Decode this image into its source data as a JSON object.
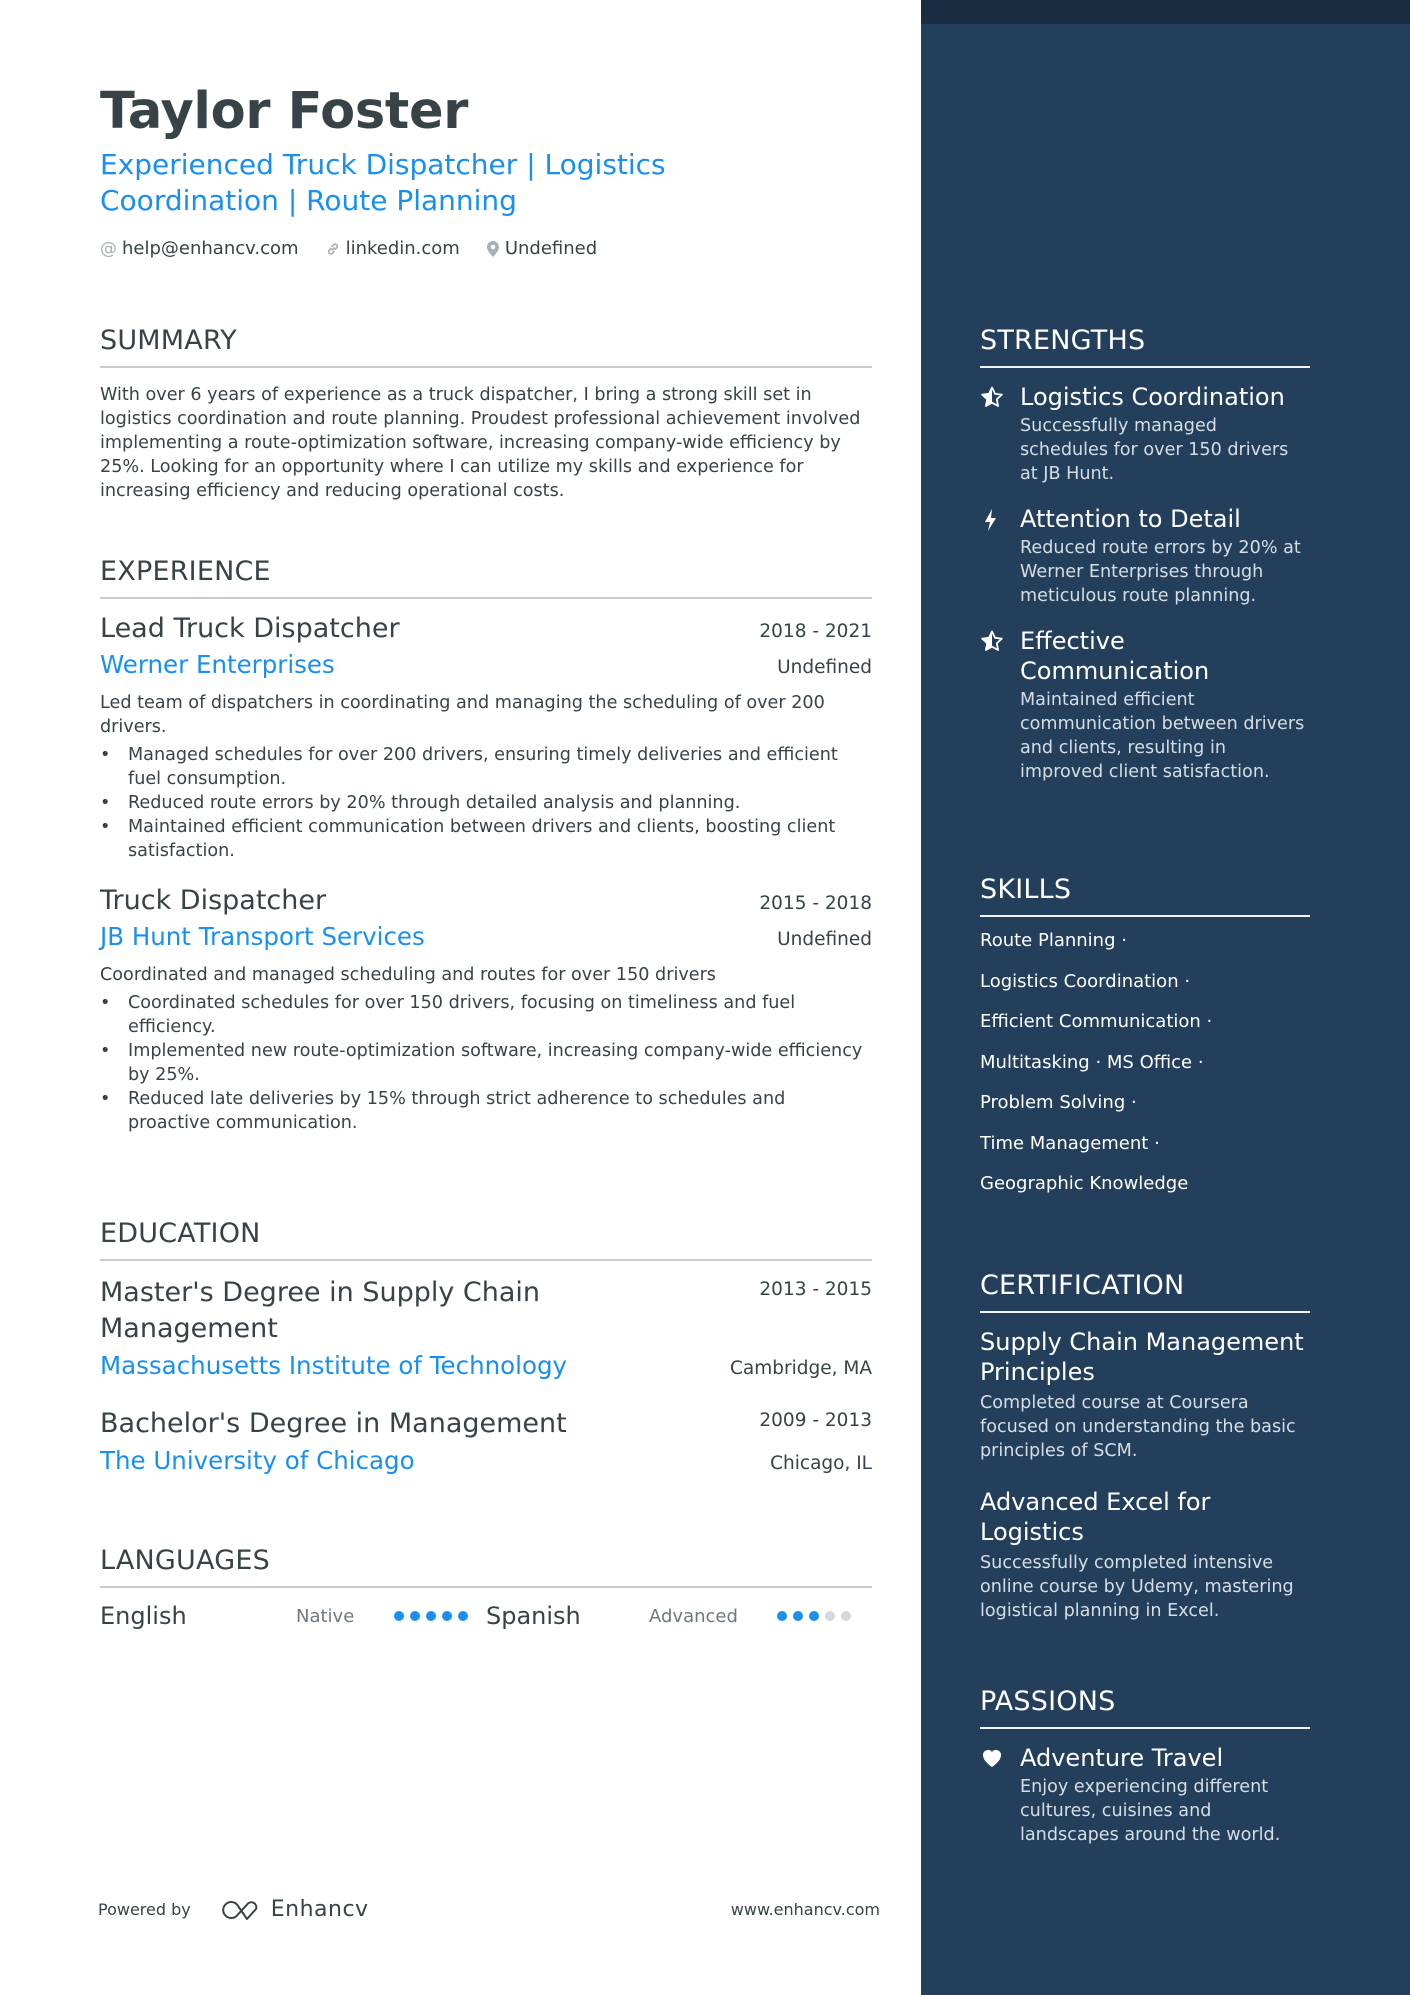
{
  "header": {
    "name": "Taylor Foster",
    "headline": "Experienced Truck Dispatcher | Logistics Coordination | Route Planning",
    "contacts": [
      {
        "icon": "at-icon",
        "text": "help@enhancv.com"
      },
      {
        "icon": "link-icon",
        "text": "linkedin.com"
      },
      {
        "icon": "location-pin-icon",
        "text": "Undefined"
      }
    ]
  },
  "summary": {
    "title": "SUMMARY",
    "text": "With over 6 years of experience as a truck dispatcher, I bring a strong skill set in logistics coordination and route planning. Proudest professional achievement involved implementing a route-optimization software, increasing company-wide efficiency by 25%. Looking for an opportunity where I can utilize my skills and experience for increasing efficiency and reducing operational costs."
  },
  "experience": {
    "title": "EXPERIENCE",
    "jobs": [
      {
        "title": "Lead Truck Dispatcher",
        "dates": "2018 - 2021",
        "company": "Werner Enterprises",
        "location": "Undefined",
        "description": "Led team of dispatchers in coordinating and managing the scheduling of over 200 drivers.",
        "bullets": [
          "Managed schedules for over 200 drivers, ensuring timely deliveries and efficient fuel consumption.",
          "Reduced route errors by 20% through detailed analysis and planning.",
          "Maintained efficient communication between drivers and clients, boosting client satisfaction."
        ]
      },
      {
        "title": "Truck Dispatcher",
        "dates": "2015 - 2018",
        "company": "JB Hunt Transport Services",
        "location": "Undefined",
        "description": "Coordinated and managed scheduling and routes for over 150 drivers",
        "bullets": [
          "Coordinated schedules for over 150 drivers, focusing on timeliness and fuel efficiency.",
          "Implemented new route-optimization software, increasing company-wide efficiency by 25%.",
          "Reduced late deliveries by 15% through strict adherence to schedules and proactive communication."
        ]
      }
    ]
  },
  "education": {
    "title": "EDUCATION",
    "items": [
      {
        "degree": "Master's Degree in Supply Chain Management",
        "dates": "2013 - 2015",
        "school": "Massachusetts Institute of Technology",
        "location": "Cambridge, MA"
      },
      {
        "degree": "Bachelor's Degree in Management",
        "dates": "2009 - 2013",
        "school": "The University of Chicago",
        "location": "Chicago, IL"
      }
    ]
  },
  "languages": {
    "title": "LANGUAGES",
    "items": [
      {
        "name": "English",
        "level": "Native",
        "rating": 5,
        "max": 5
      },
      {
        "name": "Spanish",
        "level": "Advanced",
        "rating": 3,
        "max": 5
      }
    ]
  },
  "footer": {
    "powered_by": "Powered by",
    "brand": "Enhancv",
    "website": "www.enhancv.com"
  },
  "strengths": {
    "title": "STRENGTHS",
    "items": [
      {
        "icon": "star-half-icon",
        "title": "Logistics Coordination",
        "description": "Successfully managed schedules for over 150 drivers at JB Hunt."
      },
      {
        "icon": "lightning-bolt-icon",
        "title": "Attention to Detail",
        "description": "Reduced route errors by 20% at Werner Enterprises through meticulous route planning."
      },
      {
        "icon": "star-half-icon",
        "title": "Effective Communication",
        "description": "Maintained efficient communication between drivers and clients, resulting in improved client satisfaction."
      }
    ]
  },
  "skills": {
    "title": "SKILLS",
    "lines": [
      "Route Planning ·",
      "Logistics Coordination ·",
      "Efficient Communication ·",
      "Multitasking · MS Office ·",
      "Problem Solving ·",
      "Time Management ·",
      "Geographic Knowledge"
    ]
  },
  "certification": {
    "title": "CERTIFICATION",
    "items": [
      {
        "title": "Supply Chain Management Principles",
        "description": "Completed course at Coursera focused on understanding the basic principles of SCM."
      },
      {
        "title": "Advanced Excel for Logistics",
        "description": "Successfully completed intensive online course by Udemy, mastering logistical planning in Excel."
      }
    ]
  },
  "passions": {
    "title": "PASSIONS",
    "items": [
      {
        "icon": "heart-icon",
        "title": "Adventure Travel",
        "description": "Enjoy experiencing different cultures, cuisines and landscapes around the world."
      }
    ]
  },
  "colors": {
    "accent": "#1a8ff0",
    "text": "#384347",
    "sidebar_bg": "#233f5c",
    "sidebar_strip": "#1a2c42",
    "dot_inactive": "#d5d8da"
  }
}
